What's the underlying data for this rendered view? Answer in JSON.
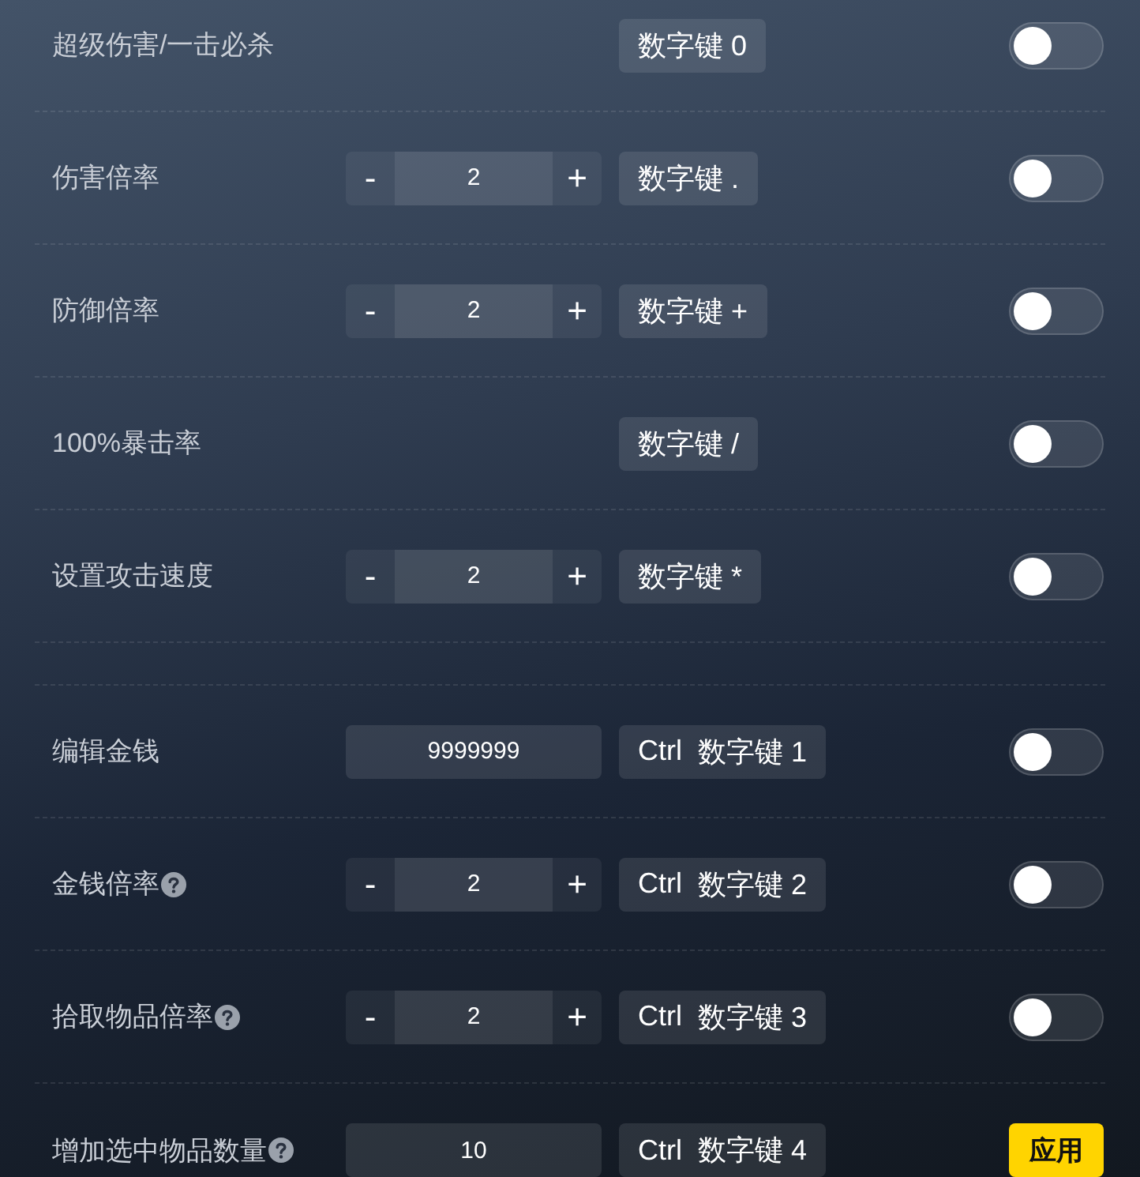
{
  "groups": [
    {
      "rows": [
        {
          "label": "超级伤害/一击必杀",
          "control": {
            "kind": "none"
          },
          "hotkey": [
            "数字键 0"
          ],
          "action": {
            "kind": "toggle",
            "on": false
          }
        },
        {
          "label": "伤害倍率",
          "control": {
            "kind": "stepper",
            "minus": "-",
            "value": "2",
            "plus": "+"
          },
          "hotkey": [
            "数字键 ."
          ],
          "action": {
            "kind": "toggle",
            "on": false
          }
        },
        {
          "label": "防御倍率",
          "control": {
            "kind": "stepper",
            "minus": "-",
            "value": "2",
            "plus": "+"
          },
          "hotkey": [
            "数字键 +"
          ],
          "action": {
            "kind": "toggle",
            "on": false
          }
        },
        {
          "label": "100%暴击率",
          "control": {
            "kind": "none"
          },
          "hotkey": [
            "数字键 /"
          ],
          "action": {
            "kind": "toggle",
            "on": false
          }
        },
        {
          "label": "设置攻击速度",
          "control": {
            "kind": "stepper",
            "minus": "-",
            "value": "2",
            "plus": "+"
          },
          "hotkey": [
            "数字键 *"
          ],
          "action": {
            "kind": "toggle",
            "on": false
          }
        }
      ]
    },
    {
      "rows": [
        {
          "label": "编辑金钱",
          "control": {
            "kind": "input",
            "value": "9999999"
          },
          "hotkey": [
            "Ctrl",
            "数字键 1"
          ],
          "action": {
            "kind": "toggle",
            "on": false
          }
        },
        {
          "label": "金钱倍率",
          "hint": {
            "kind": "help"
          },
          "control": {
            "kind": "stepper",
            "minus": "-",
            "value": "2",
            "plus": "+"
          },
          "hotkey": [
            "Ctrl",
            "数字键 2"
          ],
          "action": {
            "kind": "toggle",
            "on": false
          }
        },
        {
          "label": "拾取物品倍率",
          "hint": {
            "kind": "help"
          },
          "control": {
            "kind": "stepper",
            "minus": "-",
            "value": "2",
            "plus": "+"
          },
          "hotkey": [
            "Ctrl",
            "数字键 3"
          ],
          "action": {
            "kind": "toggle",
            "on": false
          }
        },
        {
          "label": "增加选中物品数量",
          "hint": {
            "kind": "help"
          },
          "control": {
            "kind": "input",
            "value": "10"
          },
          "hotkey": [
            "Ctrl",
            "数字键 4"
          ],
          "action": {
            "kind": "button",
            "label": "应用"
          }
        }
      ]
    }
  ]
}
